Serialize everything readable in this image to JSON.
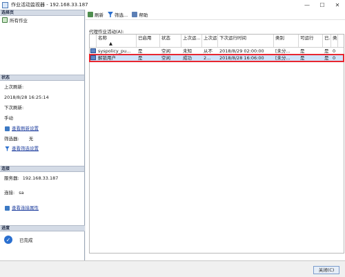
{
  "window": {
    "title": "作业活动监视器 - 192.168.33.187",
    "minimize": "—",
    "maximize": "☐",
    "close": "✕"
  },
  "left": {
    "select_page_header": "选择页",
    "all_jobs": "所有作业",
    "status_header": "状态",
    "last_refresh_label": "上次刷新:",
    "last_refresh_value": "2018/8/28 16:25:14",
    "next_refresh_label": "下次刷新:",
    "next_refresh_value": "手动",
    "view_refresh_settings": "查看刷新设置",
    "filter_label": "筛选器:",
    "filter_value": "无",
    "view_filter_settings": "查看筛选设置",
    "connection_header": "连接",
    "server_label": "服务器:",
    "server_value": "192.168.33.187",
    "conn_label": "连接:",
    "conn_value": "sa",
    "view_conn_props": "查看连接属性",
    "progress_header": "进度",
    "progress_value": "已完成"
  },
  "toolbar": {
    "refresh": "刷新",
    "filter": "筛选...",
    "help": "帮助"
  },
  "list_title": "代理作业活动(A):",
  "columns": [
    [
      "",
      ""
    ],
    [
      "名称",
      "▲"
    ],
    [
      "已启用",
      ""
    ],
    [
      "状态",
      ""
    ],
    [
      "上次运...",
      ""
    ],
    [
      "上次运...",
      ""
    ],
    [
      "下次运行时间",
      ""
    ],
    [
      "类别",
      ""
    ],
    [
      "可运行",
      ""
    ],
    [
      "已...",
      ""
    ],
    [
      "类别",
      ""
    ]
  ],
  "rows": [
    [
      "",
      "syspolicy_pu...",
      "是",
      "空闲",
      "未知",
      "从不",
      "2018/8/29 02:00:00",
      "[未分...",
      "是",
      "是",
      "0"
    ],
    [
      "",
      "解锁用户",
      "是",
      "空闲",
      "成功",
      "2...",
      "2018/8/28 16:06:00",
      "[未分...",
      "是",
      "是",
      "0"
    ]
  ],
  "buttons": {
    "close": "关闭(C)"
  }
}
